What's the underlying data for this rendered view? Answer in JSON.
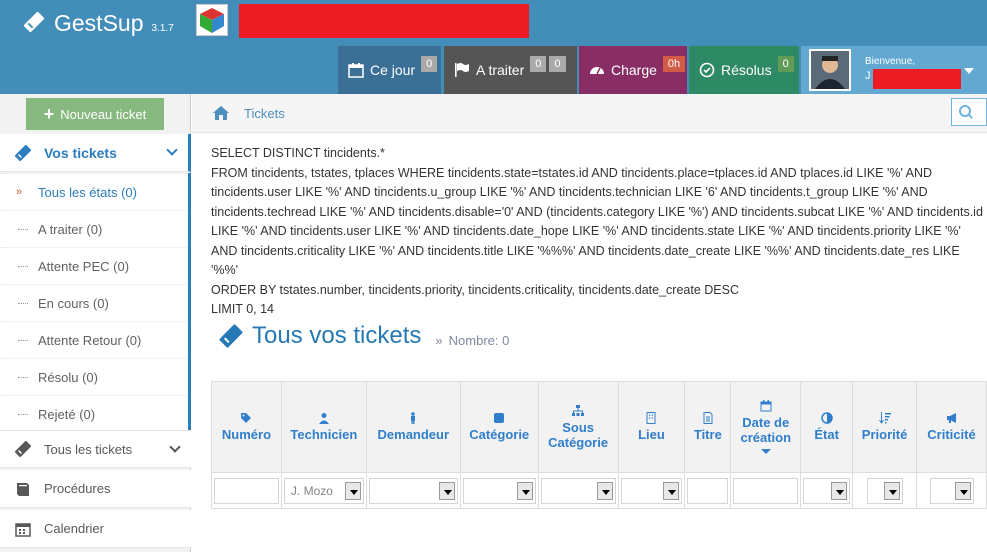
{
  "brand": {
    "name": "GestSup",
    "version": "3.1.7"
  },
  "nav": [
    {
      "label": "Ce jour",
      "badges": [
        "0"
      ],
      "icon": "calendar-icon"
    },
    {
      "label": "A traiter",
      "badges": [
        "0",
        "0"
      ],
      "icon": "flag-icon"
    },
    {
      "label": "Charge",
      "badges": [
        "0h"
      ],
      "icon": "dashboard-icon"
    },
    {
      "label": "Résolus",
      "badges": [
        "0"
      ],
      "icon": "check-circle-icon"
    }
  ],
  "user": {
    "welcome": "Bienvenue,",
    "name_initial": "J"
  },
  "sidebar": {
    "new_ticket": "Nouveau ticket",
    "vos_tickets": "Vos tickets",
    "sub_items": [
      "Tous les états (0)",
      "A traiter (0)",
      "Attente PEC (0)",
      "En cours (0)",
      "Attente Retour (0)",
      "Résolu (0)",
      "Rejeté (0)"
    ],
    "tous_tickets": "Tous les tickets",
    "procedures": "Procédures",
    "calendrier": "Calendrier"
  },
  "breadcrumb": {
    "label": "Tickets"
  },
  "sql": {
    "l1": "SELECT DISTINCT tincidents.*",
    "l2": "FROM tincidents, tstates, tplaces WHERE tincidents.state=tstates.id AND tincidents.place=tplaces.id AND tplaces.id LIKE '%' AND tincidents.user LIKE '%' AND tincidents.u_group LIKE '%' AND tincidents.technician LIKE '6' AND tincidents.t_group LIKE '%' AND tincidents.techread LIKE '%' AND tincidents.disable='0' AND (tincidents.category LIKE '%') AND tincidents.subcat LIKE '%' AND tincidents.id LIKE '%' AND tincidents.user LIKE '%' AND tincidents.date_hope LIKE '%' AND tincidents.state LIKE '%' AND tincidents.priority LIKE '%' AND tincidents.criticality LIKE '%' AND tincidents.title LIKE '%%%' AND tincidents.date_create LIKE '%%' AND tincidents.date_res LIKE '%%'",
    "l3": "ORDER BY tstates.number, tincidents.priority, tincidents.criticality, tincidents.date_create DESC",
    "l4": "LIMIT 0, 14"
  },
  "page": {
    "title": "Tous vos tickets",
    "count_sep": "»",
    "count": "Nombre: 0"
  },
  "table": {
    "headers": [
      "Numéro",
      "Technicien",
      "Demandeur",
      "Catégorie",
      "Sous Catégorie",
      "Lieu",
      "Titre",
      "Date de création",
      "État",
      "Priorité",
      "Criticité"
    ],
    "filter_technician": "J. Mozo"
  },
  "colors": {
    "topbar": "#438eb9",
    "accent": "#2b7dbc",
    "new_ticket": "#87b87f"
  }
}
